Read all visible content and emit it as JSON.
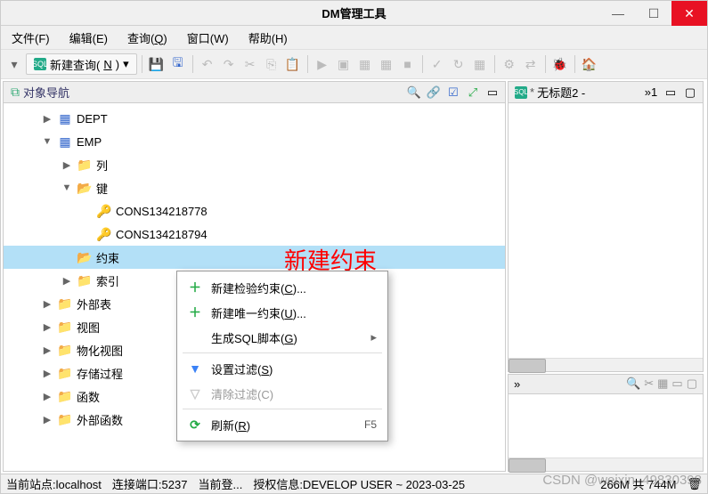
{
  "window": {
    "title": "DM管理工具"
  },
  "menubar": {
    "file": "文件(F)",
    "edit": "编辑(E)",
    "query": "查询(",
    "query_u": "Q",
    "query_suf": ")",
    "window": "窗口(W)",
    "help": "帮助(H)"
  },
  "toolbar": {
    "new_query_label": "新建查询(",
    "new_query_u": "N",
    "new_query_suf": ")"
  },
  "nav": {
    "title": "对象导航",
    "items": [
      {
        "indent": 30,
        "arrow": "▶",
        "iconType": "table",
        "icon": "▦",
        "label": "DEPT",
        "selected": false
      },
      {
        "indent": 30,
        "arrow": "▼",
        "iconType": "table",
        "icon": "▦",
        "label": "EMP",
        "selected": false
      },
      {
        "indent": 52,
        "arrow": "▶",
        "iconType": "folder",
        "icon": "📁",
        "label": "列",
        "selected": false
      },
      {
        "indent": 52,
        "arrow": "▼",
        "iconType": "folder-open",
        "icon": "📂",
        "label": "键",
        "selected": false
      },
      {
        "indent": 74,
        "arrow": "",
        "iconType": "key",
        "icon": "🔑",
        "label": "CONS134218778",
        "selected": false
      },
      {
        "indent": 74,
        "arrow": "",
        "iconType": "key",
        "icon": "🔑",
        "label": "CONS134218794",
        "selected": false
      },
      {
        "indent": 52,
        "arrow": "",
        "iconType": "folder-open",
        "icon": "📂",
        "label": "约束",
        "selected": true
      },
      {
        "indent": 52,
        "arrow": "▶",
        "iconType": "folder",
        "icon": "📁",
        "label": "索引",
        "selected": false
      },
      {
        "indent": 30,
        "arrow": "▶",
        "iconType": "folder",
        "icon": "📁",
        "label": "外部表",
        "selected": false
      },
      {
        "indent": 30,
        "arrow": "▶",
        "iconType": "folder",
        "icon": "📁",
        "label": "视图",
        "selected": false
      },
      {
        "indent": 30,
        "arrow": "▶",
        "iconType": "folder",
        "icon": "📁",
        "label": "物化视图",
        "selected": false
      },
      {
        "indent": 30,
        "arrow": "▶",
        "iconType": "folder",
        "icon": "📁",
        "label": "存储过程",
        "selected": false
      },
      {
        "indent": 30,
        "arrow": "▶",
        "iconType": "folder",
        "icon": "📁",
        "label": "函数",
        "selected": false
      },
      {
        "indent": 30,
        "arrow": "▶",
        "iconType": "folder",
        "icon": "📁",
        "label": "外部函数",
        "selected": false
      }
    ]
  },
  "context_menu": {
    "new_check": "新建检验约束(",
    "new_check_u": "C",
    "new_check_suf": ")...",
    "new_unique": "新建唯一约束(",
    "new_unique_u": "U",
    "new_unique_suf": ")...",
    "gen_sql": "生成SQL脚本(",
    "gen_sql_u": "G",
    "gen_sql_suf": ")",
    "set_filter": "设置过滤(",
    "set_filter_u": "S",
    "set_filter_suf": ")",
    "clear_filter": "清除过滤(C)",
    "refresh": "刷新(",
    "refresh_u": "R",
    "refresh_suf": ")",
    "refresh_key": "F5"
  },
  "annotation": "新建约束",
  "editor": {
    "tab_label": "无标题2 -",
    "tab_count": "1"
  },
  "status": {
    "host_label": "当前站点:localhost",
    "port_label": "连接端口:5237",
    "login_label": "当前登...",
    "auth_label": "授权信息:DEVELOP USER ~ 2023-03-25",
    "mem_label": "266M 共 744M"
  },
  "watermark": "CSDN @weixin_49830398"
}
